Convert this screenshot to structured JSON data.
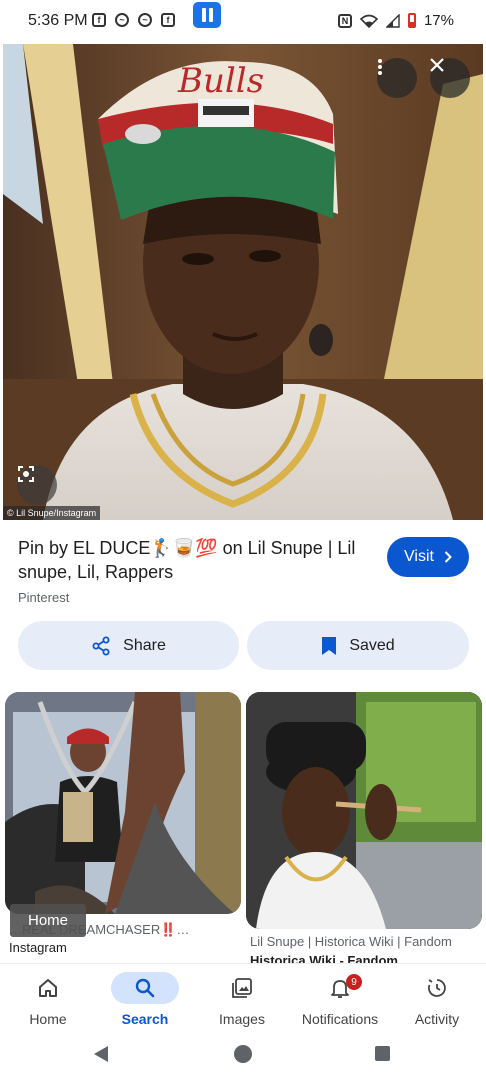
{
  "status_bar": {
    "time": "5:36 PM",
    "battery": "17%",
    "icons": [
      "facebook-icon",
      "messenger-icon",
      "messenger-icon",
      "facebook-icon",
      "pause-app-icon",
      "nfc-icon",
      "wifi-icon",
      "signal-icon",
      "battery-icon"
    ]
  },
  "hero": {
    "credit": "© Lil Snupe/Instagram",
    "buttons": {
      "more": "more-vert-icon",
      "close": "close-icon",
      "lens": "lens-icon"
    }
  },
  "result": {
    "title": "Pin by EL DUCE🏌🥃💯 on Lil Snupe | Lil snupe, Lil, Rappers",
    "source": "Pinterest",
    "visit_label": "Visit"
  },
  "actions": {
    "share_label": "Share",
    "saved_label": "Saved"
  },
  "related": [
    {
      "caption_prefix": "…REAL DREAMCHASER",
      "caption_emoji": "‼️",
      "caption_suffix": "…",
      "source": "Instagram"
    },
    {
      "caption": "Lil Snupe | Historica Wiki | Fandom",
      "source": "Historica Wiki - Fandom"
    }
  ],
  "tooltip": "Home",
  "bottom_nav": {
    "items": [
      {
        "label": "Home",
        "icon": "home-icon"
      },
      {
        "label": "Search",
        "icon": "search-icon"
      },
      {
        "label": "Images",
        "icon": "images-icon"
      },
      {
        "label": "Notifications",
        "icon": "bell-icon",
        "badge": "9"
      },
      {
        "label": "Activity",
        "icon": "activity-icon"
      }
    ],
    "active": "Search"
  },
  "colors": {
    "accent": "#0b57d0",
    "chip_bg": "#e6ecf8",
    "badge": "#c5221f"
  }
}
